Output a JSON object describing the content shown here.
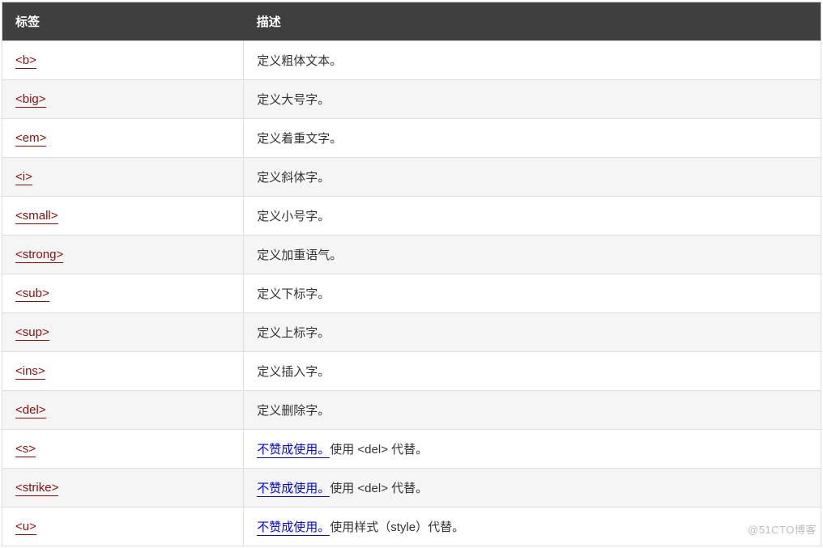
{
  "table": {
    "headers": {
      "tag": "标签",
      "description": "描述"
    },
    "rows": [
      {
        "tag": "<b>",
        "desc_plain": "定义粗体文本。",
        "deprecated": false
      },
      {
        "tag": "<big>",
        "desc_plain": "定义大号字。",
        "deprecated": false
      },
      {
        "tag": "<em>",
        "desc_plain": "定义着重文字。",
        "deprecated": false
      },
      {
        "tag": "<i>",
        "desc_plain": "定义斜体字。",
        "deprecated": false
      },
      {
        "tag": "<small>",
        "desc_plain": "定义小号字。",
        "deprecated": false
      },
      {
        "tag": "<strong>",
        "desc_plain": "定义加重语气。",
        "deprecated": false
      },
      {
        "tag": "<sub>",
        "desc_plain": "定义下标字。",
        "deprecated": false
      },
      {
        "tag": "<sup>",
        "desc_plain": "定义上标字。",
        "deprecated": false
      },
      {
        "tag": "<ins>",
        "desc_plain": "定义插入字。",
        "deprecated": false
      },
      {
        "tag": "<del>",
        "desc_plain": "定义删除字。",
        "deprecated": false
      },
      {
        "tag": "<s>",
        "deprecated": true,
        "dep_label": "不赞成使用。",
        "dep_rest": "使用 <del> 代替。"
      },
      {
        "tag": "<strike>",
        "deprecated": true,
        "dep_label": "不赞成使用。",
        "dep_rest": "使用 <del> 代替。"
      },
      {
        "tag": "<u>",
        "deprecated": true,
        "dep_label": "不赞成使用。",
        "dep_rest": "使用样式（style）代替。"
      }
    ]
  },
  "watermark": "@51CTO博客"
}
